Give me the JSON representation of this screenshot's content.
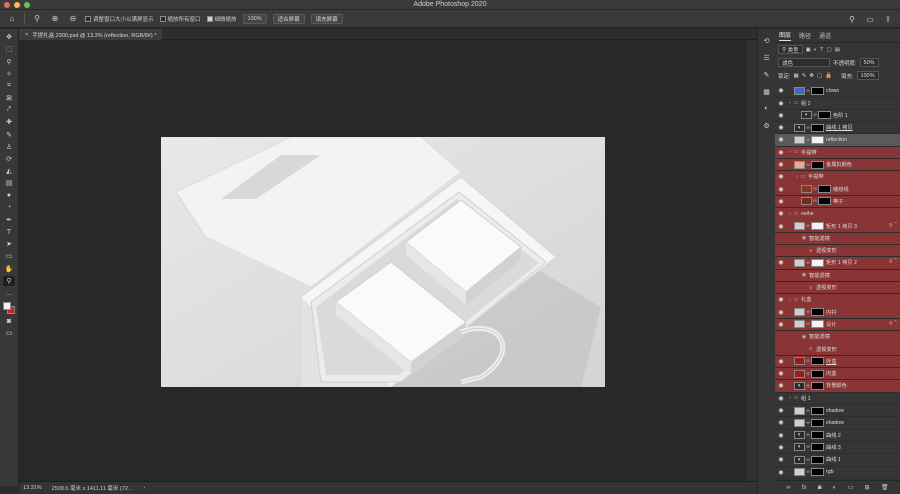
{
  "app": {
    "title": "Adobe Photoshop 2020",
    "colors": {
      "close": "#ed6a5e",
      "minimize": "#f5bf4f",
      "maximize": "#61c454",
      "red_layer": "#8a3535"
    }
  },
  "options": {
    "zoom_icon": "zoom-icon",
    "resize_windows": "调整窗口大小以满屏显示",
    "zoom_all": "缩放所有窗口",
    "scrubby_zoom": "细微缩放",
    "zoom_value": "100%",
    "fit_screen": "适合屏幕",
    "fill_screen": "填充屏幕"
  },
  "document": {
    "tab_label": "手提礼盒.2300.psd @ 13.3% (reflection, RGB/8#) *",
    "close": "×"
  },
  "status": {
    "zoom": "13.31%",
    "size": "2508.6 毫米 x 1411.11 毫米 (72…",
    "arrow": "›"
  },
  "panel": {
    "tabs": [
      "图层",
      "路径",
      "通道"
    ],
    "filter_kind": "类型",
    "blend_mode": "滤色",
    "opacity_label": "不透明度:",
    "opacity_value": "50%",
    "lock_label": "锁定:",
    "fill_label": "填充:",
    "fill_value": "100%"
  },
  "layers": [
    {
      "name": "clown",
      "indent": 1,
      "type": "layer",
      "thumb": "#3a6acb"
    },
    {
      "name": "组 2",
      "indent": 0,
      "type": "group"
    },
    {
      "name": "色阶 1",
      "indent": 2,
      "type": "adjust"
    },
    {
      "name": "曲线 1 拷贝",
      "indent": 1,
      "type": "adjust",
      "underline": true
    },
    {
      "name": "reflection",
      "indent": 1,
      "type": "layer",
      "selected": true
    },
    {
      "name": "手提带",
      "indent": 0,
      "type": "group",
      "red": true
    },
    {
      "name": "金属扣颜色",
      "indent": 1,
      "type": "layer",
      "red": true,
      "thumb": "#f0a98a"
    },
    {
      "name": "手提带",
      "indent": 1,
      "type": "group",
      "red": true
    },
    {
      "name": "缝纫线",
      "indent": 2,
      "type": "layer",
      "red": true,
      "thumb": "#7a3a20"
    },
    {
      "name": "带子",
      "indent": 2,
      "type": "layer",
      "red": true,
      "thumb": "#7a2a1a"
    },
    {
      "name": "neihe",
      "indent": 0,
      "type": "group",
      "red": true
    },
    {
      "name": "矩形 1 拷贝 3",
      "indent": 1,
      "type": "smart",
      "red": true
    },
    {
      "name": "智能滤镜",
      "indent": 2,
      "type": "sub",
      "red": true
    },
    {
      "name": "透视变形",
      "indent": 3,
      "type": "sub",
      "red": true
    },
    {
      "name": "矩形 1 拷贝 2",
      "indent": 1,
      "type": "smart",
      "red": true
    },
    {
      "name": "智能滤镜",
      "indent": 2,
      "type": "sub",
      "red": true
    },
    {
      "name": "透视变形",
      "indent": 3,
      "type": "sub",
      "red": true
    },
    {
      "name": "礼盒",
      "indent": 0,
      "type": "group",
      "red": true
    },
    {
      "name": "内衬",
      "indent": 1,
      "type": "layer",
      "red": true
    },
    {
      "name": "设计",
      "indent": 1,
      "type": "smart",
      "red": true
    },
    {
      "name": "智能滤镜",
      "indent": 2,
      "type": "sub",
      "red": true
    },
    {
      "name": "透视变形",
      "indent": 3,
      "type": "sub",
      "red": true
    },
    {
      "name": "外盒",
      "indent": 1,
      "type": "layer",
      "red": true,
      "thumb": "#a01a1a",
      "underline": true
    },
    {
      "name": "内盒",
      "indent": 1,
      "type": "layer",
      "red": true,
      "thumb": "#a01a1a"
    },
    {
      "name": "背景颜色",
      "indent": 1,
      "type": "adjust",
      "red": true
    },
    {
      "name": "组 1",
      "indent": 0,
      "type": "group"
    },
    {
      "name": "shadow",
      "indent": 1,
      "type": "layer"
    },
    {
      "name": "shadow",
      "indent": 1,
      "type": "layer"
    },
    {
      "name": "曲线 2",
      "indent": 1,
      "type": "adjust"
    },
    {
      "name": "曲线 3",
      "indent": 1,
      "type": "adjust"
    },
    {
      "name": "曲线 1",
      "indent": 1,
      "type": "adjust"
    },
    {
      "name": "rgb",
      "indent": 1,
      "type": "layer"
    }
  ],
  "tools": [
    "move-icon",
    "marquee-icon",
    "lasso-icon",
    "magic-wand-icon",
    "crop-icon",
    "frame-icon",
    "eyedropper-icon",
    "healing-icon",
    "brush-icon",
    "stamp-icon",
    "history-brush-icon",
    "eraser-icon",
    "gradient-icon",
    "blur-icon",
    "dodge-icon",
    "pen-icon",
    "type-icon",
    "path-select-icon",
    "rectangle-icon",
    "hand-icon",
    "zoom-tool-icon",
    "more-icon"
  ]
}
